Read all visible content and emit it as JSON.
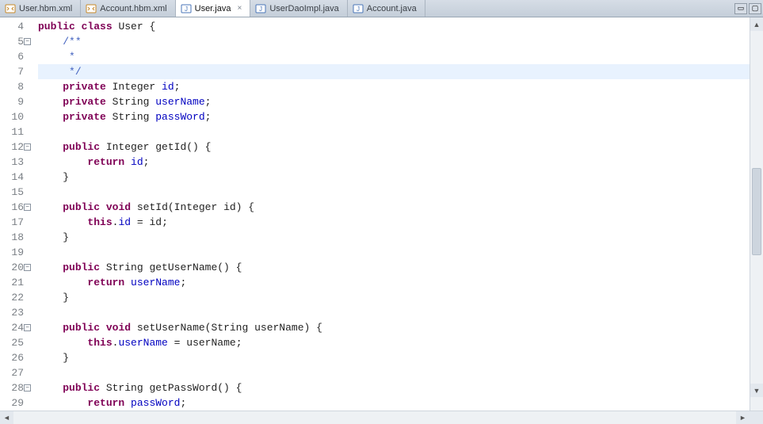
{
  "tabs": [
    {
      "label": "User.hbm.xml",
      "active": false,
      "icon": "xml"
    },
    {
      "label": "Account.hbm.xml",
      "active": false,
      "icon": "xml"
    },
    {
      "label": "User.java",
      "active": true,
      "icon": "java"
    },
    {
      "label": "UserDaoImpl.java",
      "active": false,
      "icon": "java"
    },
    {
      "label": "Account.java",
      "active": false,
      "icon": "java"
    }
  ],
  "close_glyph": "×",
  "win": {
    "min": "▭",
    "max": "▢"
  },
  "lines": [
    {
      "n": "4",
      "fold": "",
      "hl": false,
      "tokens": [
        [
          "kw",
          "public"
        ],
        [
          "plain",
          " "
        ],
        [
          "kw",
          "class"
        ],
        [
          "plain",
          " User {"
        ]
      ]
    },
    {
      "n": "5",
      "fold": "−",
      "hl": false,
      "tokens": [
        [
          "plain",
          "    "
        ],
        [
          "cm",
          "/**"
        ]
      ]
    },
    {
      "n": "6",
      "fold": "",
      "hl": false,
      "tokens": [
        [
          "plain",
          "     "
        ],
        [
          "cm",
          "*"
        ]
      ]
    },
    {
      "n": "7",
      "fold": "",
      "hl": true,
      "tokens": [
        [
          "plain",
          "     "
        ],
        [
          "cm",
          "*/"
        ]
      ]
    },
    {
      "n": "8",
      "fold": "",
      "hl": false,
      "tokens": [
        [
          "plain",
          "    "
        ],
        [
          "kw",
          "private"
        ],
        [
          "plain",
          " Integer "
        ],
        [
          "fld",
          "id"
        ],
        [
          "plain",
          ";"
        ]
      ]
    },
    {
      "n": "9",
      "fold": "",
      "hl": false,
      "tokens": [
        [
          "plain",
          "    "
        ],
        [
          "kw",
          "private"
        ],
        [
          "plain",
          " String "
        ],
        [
          "fld",
          "userName"
        ],
        [
          "plain",
          ";"
        ]
      ]
    },
    {
      "n": "10",
      "fold": "",
      "hl": false,
      "tokens": [
        [
          "plain",
          "    "
        ],
        [
          "kw",
          "private"
        ],
        [
          "plain",
          " String "
        ],
        [
          "fld",
          "passWord"
        ],
        [
          "plain",
          ";"
        ]
      ]
    },
    {
      "n": "11",
      "fold": "",
      "hl": false,
      "tokens": []
    },
    {
      "n": "12",
      "fold": "−",
      "hl": false,
      "tokens": [
        [
          "plain",
          "    "
        ],
        [
          "kw",
          "public"
        ],
        [
          "plain",
          " Integer getId() {"
        ]
      ]
    },
    {
      "n": "13",
      "fold": "",
      "hl": false,
      "tokens": [
        [
          "plain",
          "        "
        ],
        [
          "kw",
          "return"
        ],
        [
          "plain",
          " "
        ],
        [
          "fld",
          "id"
        ],
        [
          "plain",
          ";"
        ]
      ]
    },
    {
      "n": "14",
      "fold": "",
      "hl": false,
      "tokens": [
        [
          "plain",
          "    }"
        ]
      ]
    },
    {
      "n": "15",
      "fold": "",
      "hl": false,
      "tokens": []
    },
    {
      "n": "16",
      "fold": "−",
      "hl": false,
      "tokens": [
        [
          "plain",
          "    "
        ],
        [
          "kw",
          "public"
        ],
        [
          "plain",
          " "
        ],
        [
          "kw",
          "void"
        ],
        [
          "plain",
          " setId(Integer id) {"
        ]
      ]
    },
    {
      "n": "17",
      "fold": "",
      "hl": false,
      "tokens": [
        [
          "plain",
          "        "
        ],
        [
          "kw",
          "this"
        ],
        [
          "plain",
          "."
        ],
        [
          "fld",
          "id"
        ],
        [
          "plain",
          " = id;"
        ]
      ]
    },
    {
      "n": "18",
      "fold": "",
      "hl": false,
      "tokens": [
        [
          "plain",
          "    }"
        ]
      ]
    },
    {
      "n": "19",
      "fold": "",
      "hl": false,
      "tokens": []
    },
    {
      "n": "20",
      "fold": "−",
      "hl": false,
      "tokens": [
        [
          "plain",
          "    "
        ],
        [
          "kw",
          "public"
        ],
        [
          "plain",
          " String getUserName() {"
        ]
      ]
    },
    {
      "n": "21",
      "fold": "",
      "hl": false,
      "tokens": [
        [
          "plain",
          "        "
        ],
        [
          "kw",
          "return"
        ],
        [
          "plain",
          " "
        ],
        [
          "fld",
          "userName"
        ],
        [
          "plain",
          ";"
        ]
      ]
    },
    {
      "n": "22",
      "fold": "",
      "hl": false,
      "tokens": [
        [
          "plain",
          "    }"
        ]
      ]
    },
    {
      "n": "23",
      "fold": "",
      "hl": false,
      "tokens": []
    },
    {
      "n": "24",
      "fold": "−",
      "hl": false,
      "tokens": [
        [
          "plain",
          "    "
        ],
        [
          "kw",
          "public"
        ],
        [
          "plain",
          " "
        ],
        [
          "kw",
          "void"
        ],
        [
          "plain",
          " setUserName(String userName) {"
        ]
      ]
    },
    {
      "n": "25",
      "fold": "",
      "hl": false,
      "tokens": [
        [
          "plain",
          "        "
        ],
        [
          "kw",
          "this"
        ],
        [
          "plain",
          "."
        ],
        [
          "fld",
          "userName"
        ],
        [
          "plain",
          " = userName;"
        ]
      ]
    },
    {
      "n": "26",
      "fold": "",
      "hl": false,
      "tokens": [
        [
          "plain",
          "    }"
        ]
      ]
    },
    {
      "n": "27",
      "fold": "",
      "hl": false,
      "tokens": []
    },
    {
      "n": "28",
      "fold": "−",
      "hl": false,
      "tokens": [
        [
          "plain",
          "    "
        ],
        [
          "kw",
          "public"
        ],
        [
          "plain",
          " String getPassWord() {"
        ]
      ]
    },
    {
      "n": "29",
      "fold": "",
      "hl": false,
      "tokens": [
        [
          "plain",
          "        "
        ],
        [
          "kw",
          "return"
        ],
        [
          "plain",
          " "
        ],
        [
          "fld",
          "passWord"
        ],
        [
          "plain",
          ";"
        ]
      ]
    }
  ]
}
